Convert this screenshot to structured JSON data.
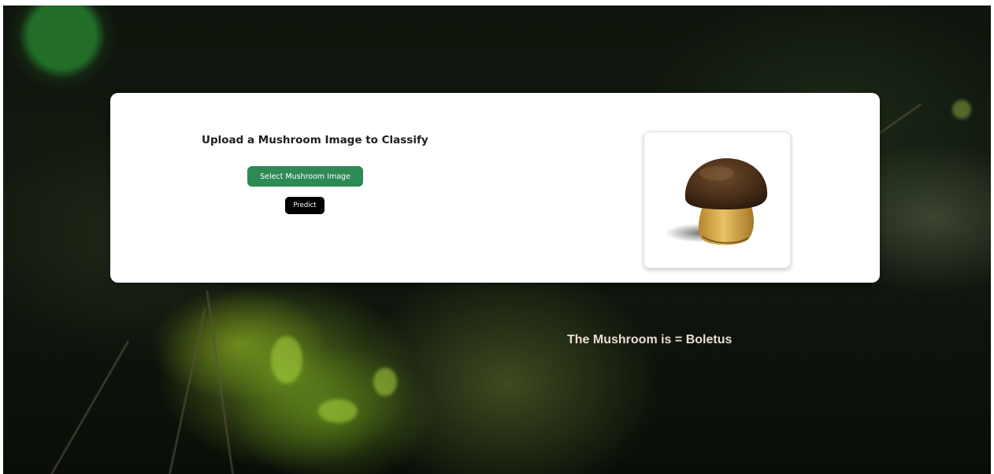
{
  "upload": {
    "title": "Upload a Mushroom Image to Classify",
    "select_label": "Select Mushroom Image",
    "predict_label": "Predict"
  },
  "preview": {
    "subject": "mushroom-image"
  },
  "result": {
    "text": "The Mushroom is = Boletus"
  },
  "colors": {
    "select_button": "#2d8a55",
    "predict_button": "#000000",
    "card": "#ffffff",
    "result_text": "#ecdcd6"
  }
}
